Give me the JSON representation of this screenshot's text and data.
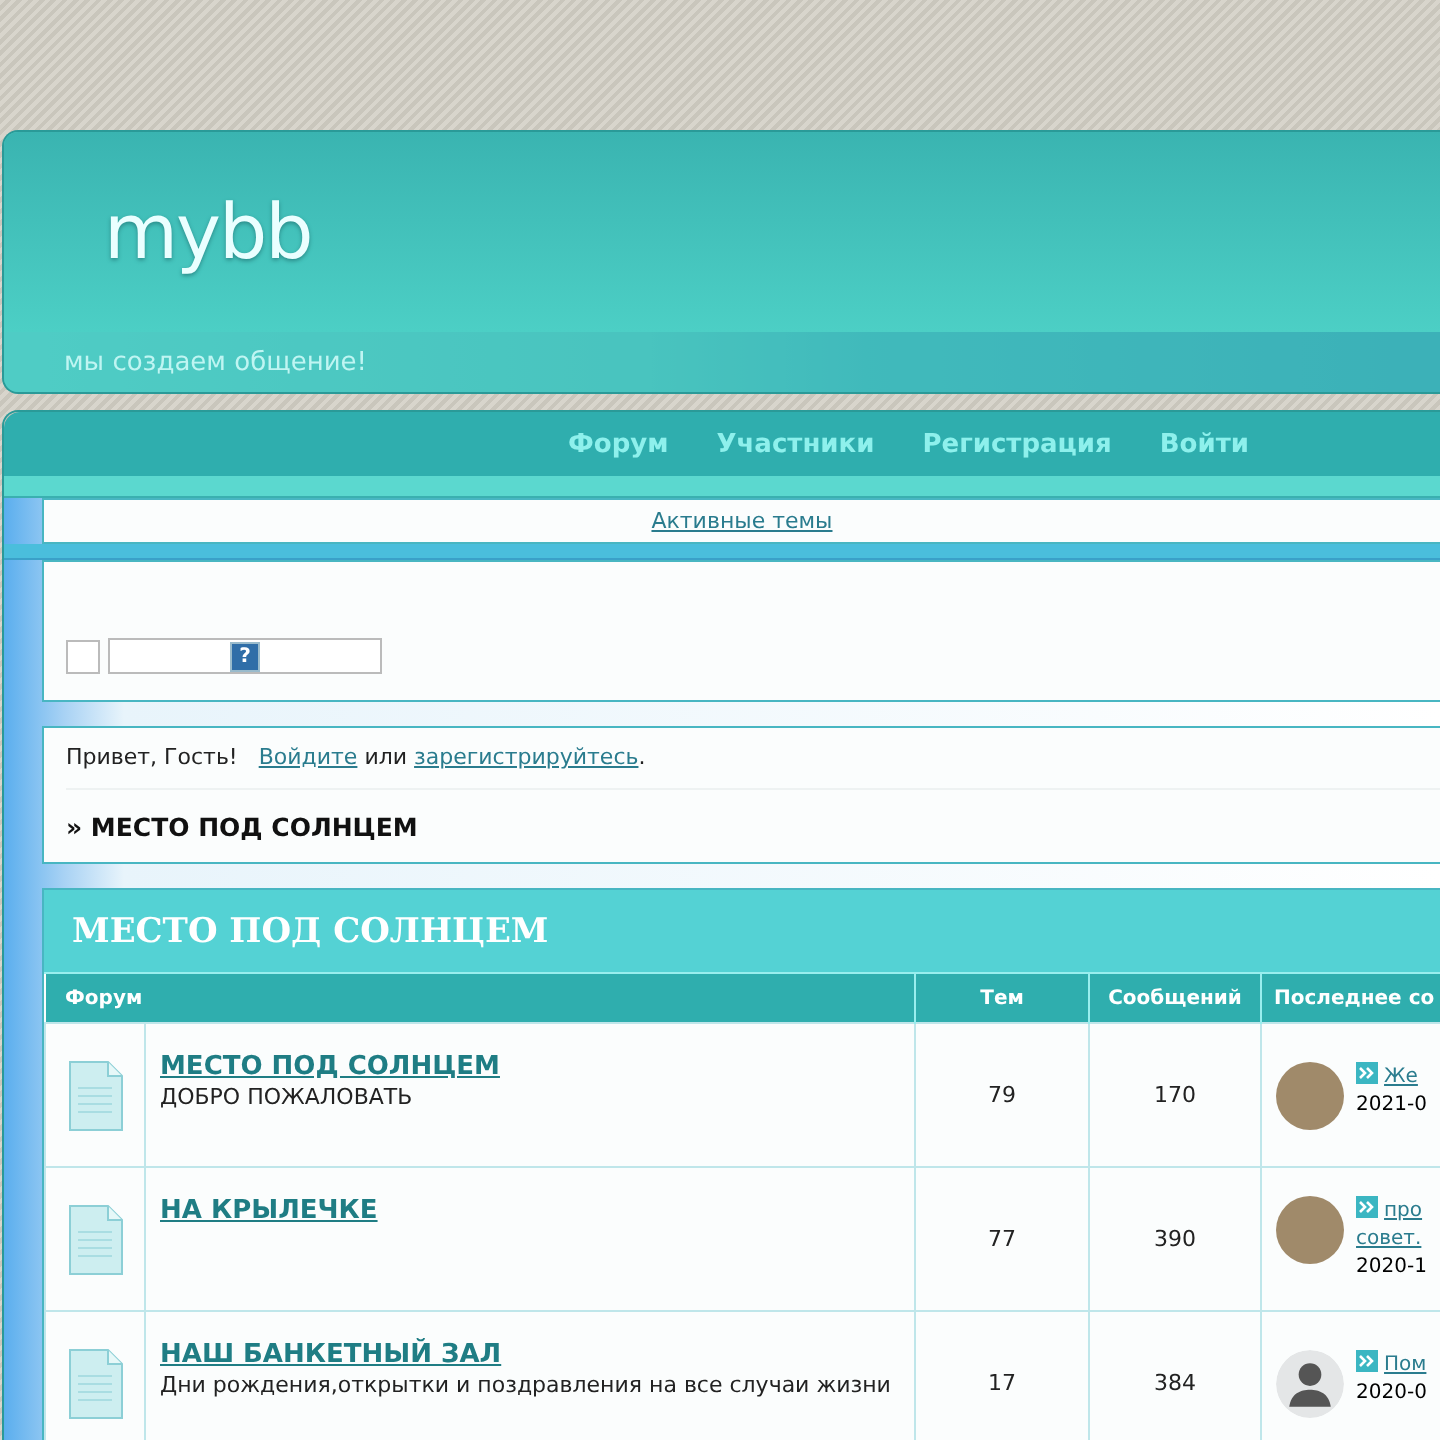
{
  "header": {
    "logo": "mybb",
    "tagline": "мы создаем общение!"
  },
  "nav": [
    {
      "label": "Форум"
    },
    {
      "label": "Участники"
    },
    {
      "label": "Регистрация"
    },
    {
      "label": "Войти"
    }
  ],
  "active_topics_link": "Активные темы",
  "search": {
    "checked": false,
    "help": "?"
  },
  "welcome": {
    "greeting": "Привет, Гость!",
    "login_link": "Войдите",
    "middle": "или",
    "register_link": "зарегистрируйтесь",
    "end": "."
  },
  "breadcrumb": "» МЕСТО ПОД СОЛНЦЕМ",
  "category": {
    "title": "МЕСТО ПОД СОЛНЦЕМ",
    "columns": [
      "Форум",
      "Тем",
      "Сообщений",
      "Последнее со"
    ],
    "rows": [
      {
        "title": "МЕСТО ПОД СОЛНЦЕМ",
        "description": "ДОБРО ПОЖАЛОВАТЬ",
        "topics": "79",
        "posts": "170",
        "last_post": {
          "kind": "photo",
          "topic": [
            "Же"
          ],
          "date": "2021-0"
        }
      },
      {
        "title": "НА КРЫЛЕЧКЕ",
        "topics": "77",
        "posts": "390",
        "last_post": {
          "kind": "photo",
          "topic": [
            "про",
            "совет."
          ],
          "date": "2020-1"
        }
      },
      {
        "title": "НАШ БАНКЕТНЫЙ ЗАЛ",
        "description": "Дни рождения,открытки и поздравления на все случаи жизни",
        "topics": "17",
        "posts": "384",
        "last_post": {
          "kind": "silhouette",
          "topic": [
            "Пом"
          ],
          "date": "2020-0"
        }
      }
    ]
  }
}
